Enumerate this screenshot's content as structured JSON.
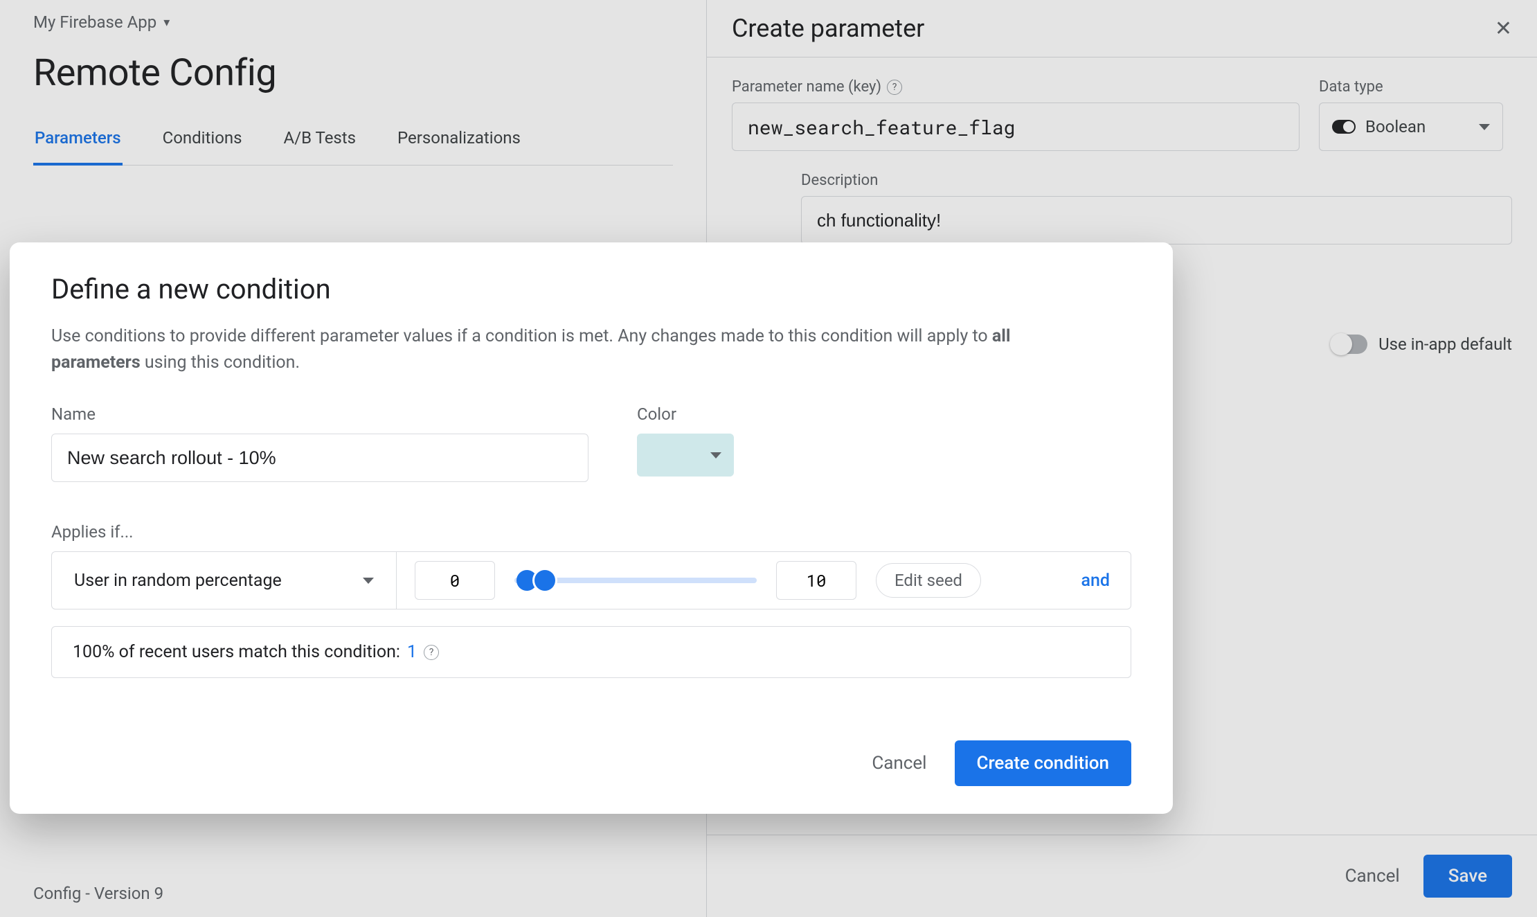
{
  "app": {
    "name": "My Firebase App"
  },
  "page": {
    "title": "Remote Config",
    "version_footer": "Config - Version 9",
    "tabs": [
      "Parameters",
      "Conditions",
      "A/B Tests",
      "Personalizations"
    ],
    "active_tab": "Parameters"
  },
  "create_param_panel": {
    "title": "Create parameter",
    "key_label": "Parameter name (key)",
    "key_value": "new_search_feature_flag",
    "type_label": "Data type",
    "type_value": "Boolean",
    "desc_label": "Description",
    "desc_value_visible_fragment": "ch functionality!",
    "use_default_label": "Use in-app default",
    "cancel": "Cancel",
    "save": "Save"
  },
  "condition_modal": {
    "title": "Define a new condition",
    "subtitle_prefix": "Use conditions to provide different parameter values if a condition is met. Any changes made to this condition will apply to ",
    "subtitle_bold": "all parameters",
    "subtitle_suffix": " using this condition.",
    "name_label": "Name",
    "name_value": "New search rollout - 10%",
    "color_label": "Color",
    "color_hex": "#cfe8ea",
    "applies_label": "Applies if...",
    "rule_type": "User in random percentage",
    "range_low": "0",
    "range_high": "10",
    "edit_seed": "Edit seed",
    "and_label": "and",
    "match_prefix": "100% of recent users match this condition: ",
    "match_count": "1",
    "cancel": "Cancel",
    "create": "Create condition"
  }
}
